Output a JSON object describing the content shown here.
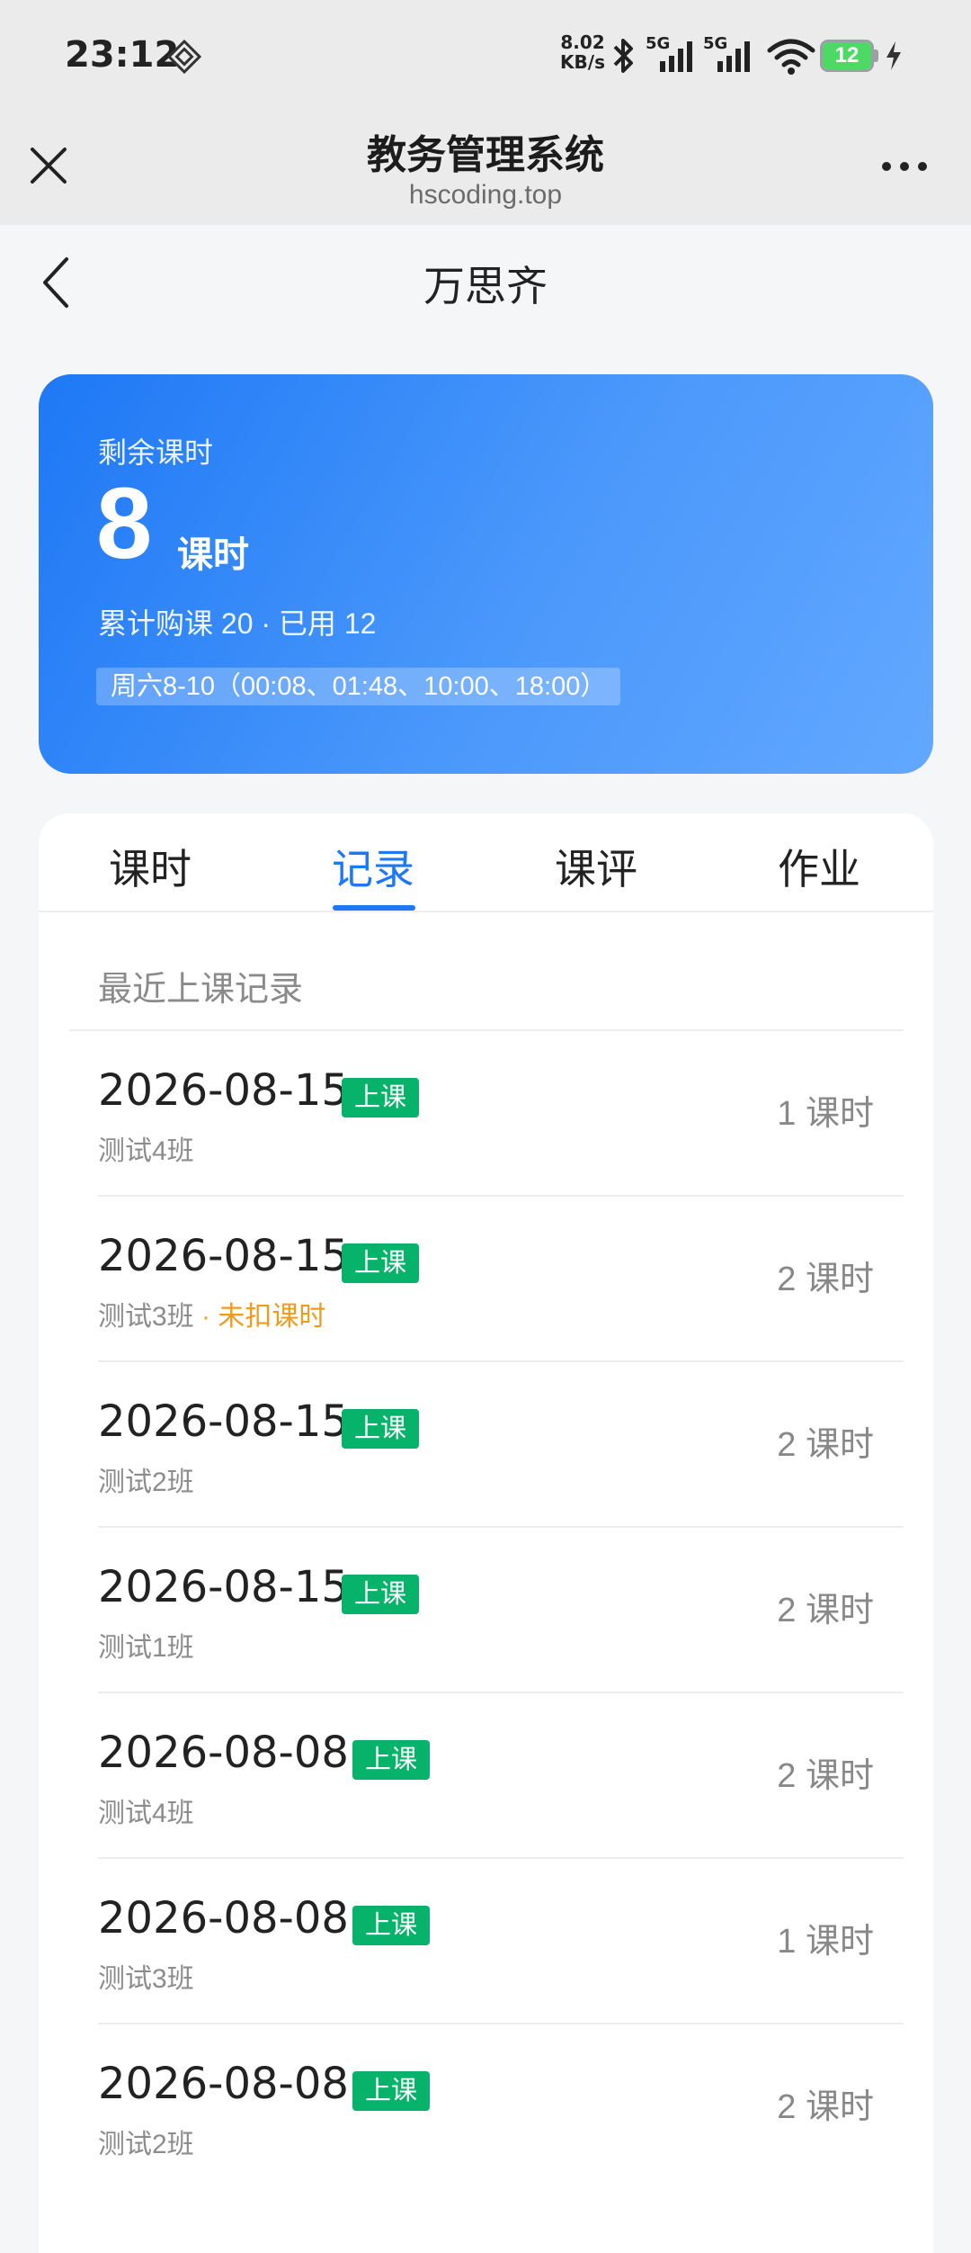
{
  "status_bar": {
    "time": "23:12",
    "netspeed_value": "8.02",
    "netspeed_unit": "KB/s",
    "signal1_label": "5G",
    "signal2_label": "5G",
    "battery": "12"
  },
  "browser": {
    "title": "教务管理系统",
    "domain": "hscoding.top"
  },
  "nav": {
    "student_name": "万思齐"
  },
  "summary": {
    "remaining_label": "剩余课时",
    "remaining_value": "8",
    "remaining_unit": "课时",
    "stats": "累计购课 20 · 已用 12",
    "schedule": "周六8-10（00:08、01:48、10:00、18:00）"
  },
  "tabs": [
    {
      "label": "课时"
    },
    {
      "label": "记录"
    },
    {
      "label": "课评"
    },
    {
      "label": "作业"
    }
  ],
  "active_tab": "记录",
  "records_section_title": "最近上课记录",
  "records": [
    {
      "date": "2026-08-15",
      "tag": "上课",
      "class": "测试4班",
      "hours": "1 课时"
    },
    {
      "date": "2026-08-15",
      "tag": "上课",
      "class": "测试3班",
      "sep": "·",
      "note": "未扣课时",
      "hours": "2 课时"
    },
    {
      "date": "2026-08-15",
      "tag": "上课",
      "class": "测试2班",
      "hours": "2 课时"
    },
    {
      "date": "2026-08-15",
      "tag": "上课",
      "class": "测试1班",
      "hours": "2 课时"
    },
    {
      "date": "2026-08-08",
      "tag": "上课",
      "class": "测试4班",
      "hours": "2 课时"
    },
    {
      "date": "2026-08-08",
      "tag": "上课",
      "class": "测试3班",
      "hours": "1 课时"
    },
    {
      "date": "2026-08-08",
      "tag": "上课",
      "class": "测试2班",
      "hours": "2 课时"
    }
  ],
  "colors": {
    "primary": "#1e78f5",
    "tag_green": "#07b36b",
    "warning": "#f09a1a"
  }
}
